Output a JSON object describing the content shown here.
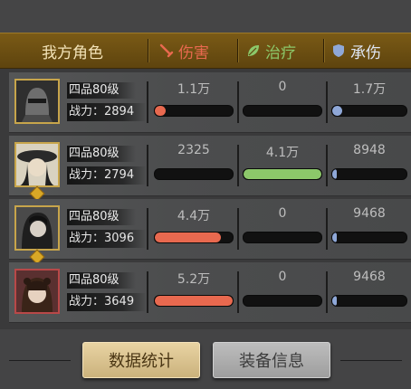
{
  "header": {
    "role_label": "我方角色",
    "damage_label": "伤害",
    "heal_label": "治疗",
    "tank_label": "承伤",
    "colors": {
      "damage": "#e8694f",
      "heal": "#8cc86a",
      "tank": "#8fa8d8"
    }
  },
  "rows": [
    {
      "rank": "四品80级",
      "power": "战力：2894",
      "damage": "1.1万",
      "damage_pct": 0.14,
      "heal": "0",
      "heal_pct": 0,
      "tank": "1.7万",
      "tank_pct": 0.13
    },
    {
      "rank": "四品80级",
      "power": "战力：2794",
      "damage": "2325",
      "damage_pct": 0,
      "heal": "4.1万",
      "heal_pct": 1.0,
      "tank": "8948",
      "tank_pct": 0.03
    },
    {
      "rank": "四品80级",
      "power": "战力：3096",
      "damage": "4.4万",
      "damage_pct": 0.85,
      "heal": "0",
      "heal_pct": 0,
      "tank": "9468",
      "tank_pct": 0.04
    },
    {
      "rank": "四品80级",
      "power": "战力：3649",
      "damage": "5.2万",
      "damage_pct": 1.0,
      "heal": "0",
      "heal_pct": 0,
      "tank": "9468",
      "tank_pct": 0.04
    }
  ],
  "buttons": {
    "stats": "数据统计",
    "equipment": "装备信息"
  }
}
